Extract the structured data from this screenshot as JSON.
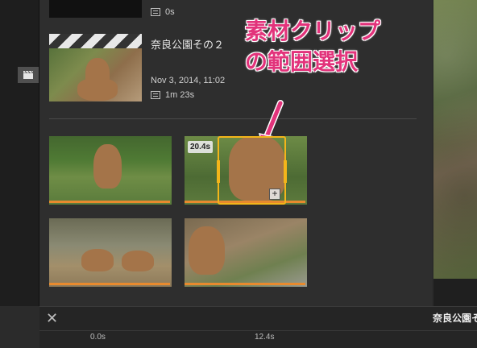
{
  "library": {
    "previous_clip": {
      "duration": "0s"
    },
    "clip": {
      "title": "奈良公園その２",
      "date": "Nov 3, 2014, 11:02",
      "duration": "1m 23s"
    }
  },
  "selection": {
    "duration_badge": "20.4s"
  },
  "annotation": {
    "line1": "素材クリップ",
    "line2": "の範囲選択",
    "color": "#e2337b"
  },
  "timeline": {
    "title": "奈良公園そ",
    "close_label": "✕",
    "ticks": [
      "0.0s",
      "12.4s"
    ]
  },
  "colors": {
    "accent_orange": "#e88a2e",
    "selection_yellow": "#f3b51a"
  }
}
